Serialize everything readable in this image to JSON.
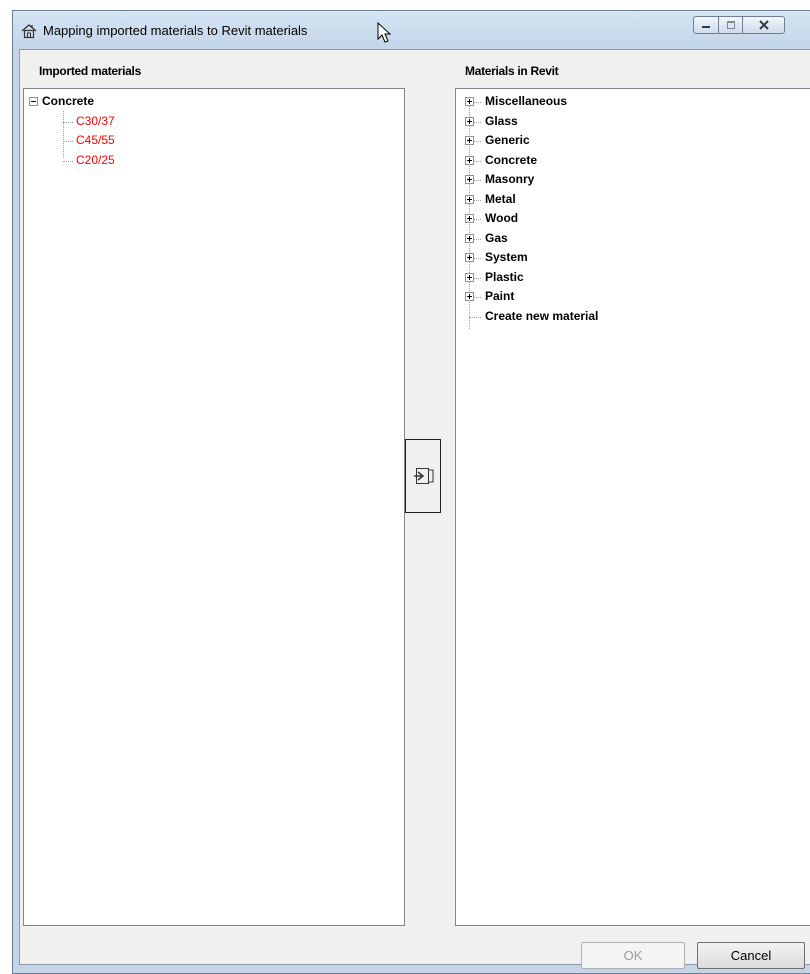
{
  "window": {
    "title": "Mapping imported materials to Revit materials"
  },
  "left_panel": {
    "label": "Imported materials",
    "root": {
      "label": "Concrete",
      "expanded": true
    },
    "children": [
      "C30/37",
      "C45/55",
      "C20/25"
    ]
  },
  "right_panel": {
    "label": "Materials in Revit",
    "items": [
      "Miscellaneous",
      "Glass",
      "Generic",
      "Concrete",
      "Masonry",
      "Metal",
      "Wood",
      "Gas",
      "System",
      "Plastic",
      "Paint"
    ],
    "leaf": "Create new material"
  },
  "buttons": {
    "ok": "OK",
    "cancel": "Cancel"
  },
  "colors": {
    "unmapped_material": "#ff0000",
    "title_bar": "#c9d9ec"
  }
}
